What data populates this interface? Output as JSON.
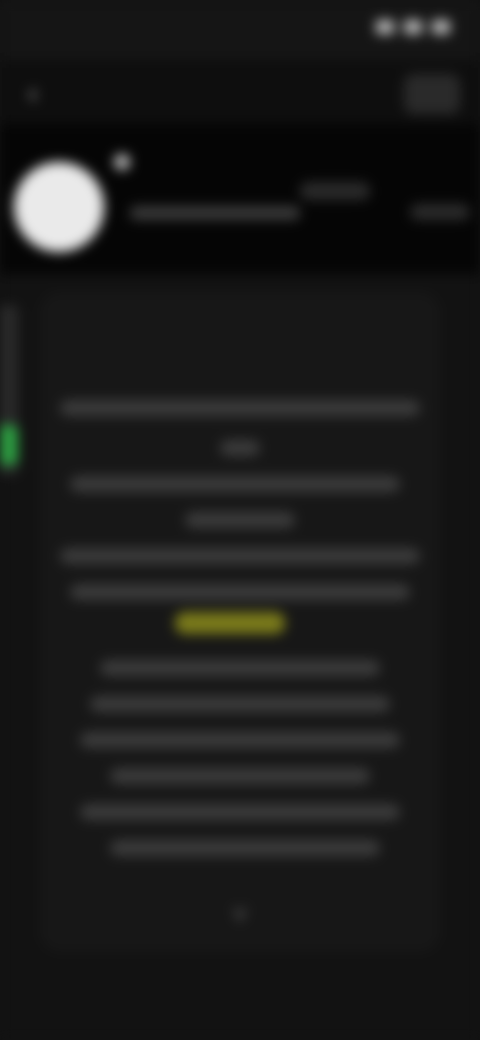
{
  "status_bar": {
    "time": "",
    "icons": [
      "wifi-icon",
      "signal-icon",
      "battery-icon"
    ]
  },
  "header": {
    "title": "",
    "back_icon": "back-arrow-icon",
    "action_icon": "menu-icon"
  },
  "profile": {
    "avatar": "avatar",
    "name": "",
    "subtitle": ""
  },
  "colors": {
    "background": "#121212",
    "card": "#171717",
    "accent_green": "#2ea043",
    "highlight_yellow": "#7a7a1a"
  }
}
